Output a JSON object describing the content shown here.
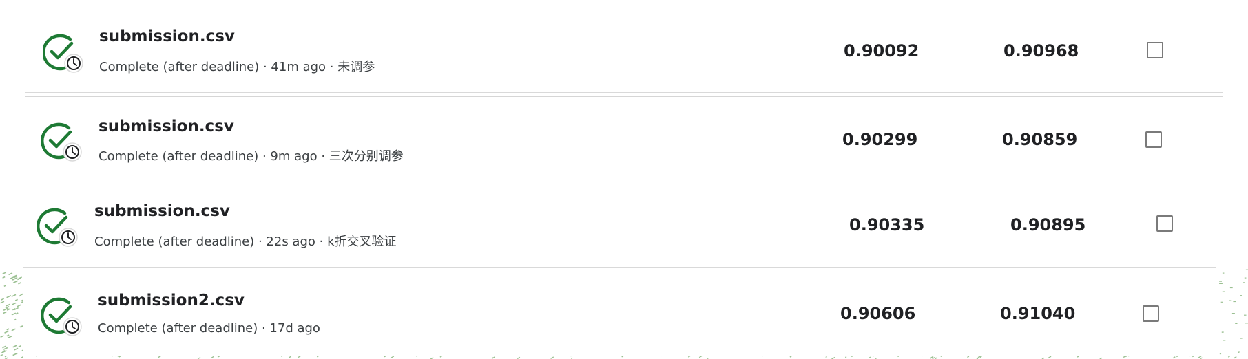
{
  "submissions": [
    {
      "filename": "submission.csv",
      "status": "Complete (after deadline) · 41m ago · 未调参",
      "private_score": "0.90092",
      "public_score": "0.90968"
    },
    {
      "filename": "submission.csv",
      "status": "Complete (after deadline) · 9m ago · 三次分别调参",
      "private_score": "0.90299",
      "public_score": "0.90859"
    },
    {
      "filename": "submission.csv",
      "status": "Complete (after deadline) · 22s ago · k折交叉验证",
      "private_score": "0.90335",
      "public_score": "0.90895"
    },
    {
      "filename": "submission2.csv",
      "status": "Complete (after deadline) · 17d ago",
      "private_score": "0.90606",
      "public_score": "0.91040"
    }
  ],
  "colors": {
    "success_green": "#1e7a34",
    "clock_dark": "#202124",
    "text_primary": "#202124",
    "text_secondary": "#3c4043",
    "divider": "#d9d9d9"
  },
  "icons": {
    "status": "check-circle-with-clock-icon",
    "select": "checkbox"
  }
}
